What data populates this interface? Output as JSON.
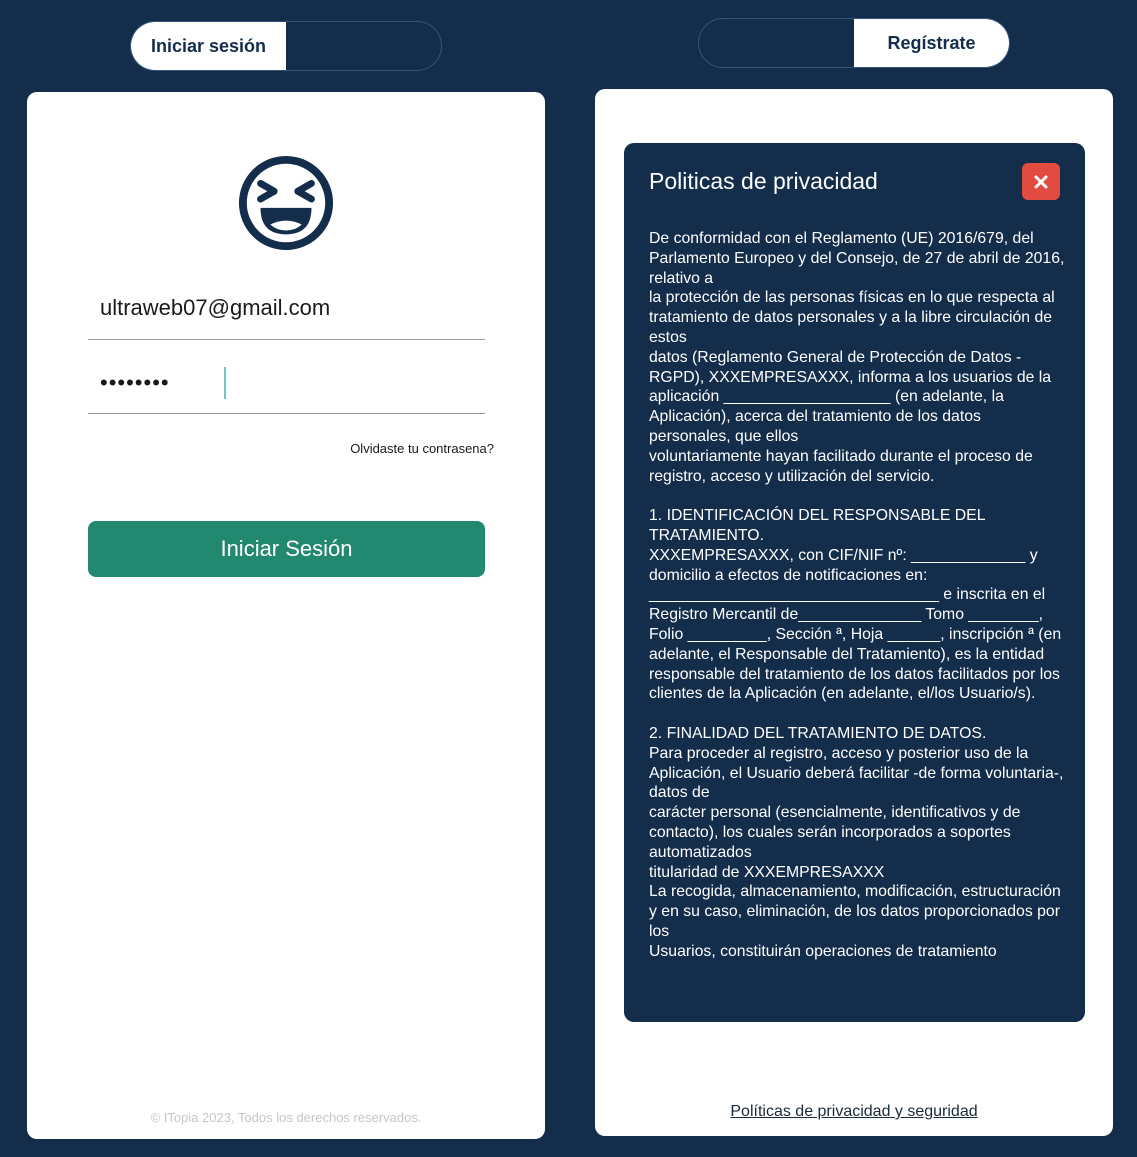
{
  "tabs": {
    "login_label": "Iniciar sesión",
    "register_label": "Regístrate"
  },
  "login": {
    "email_value": "ultraweb07@gmail.com",
    "password_masked": "••••••••",
    "forgot_label": "Olvidaste tu contrasena?",
    "submit_label": "Iniciar Sesión",
    "footer": "© ITopia 2023, Todos los derechos reservados."
  },
  "icons": {
    "avatar": "laughing-face-icon",
    "close": "close-x-icon"
  },
  "colors": {
    "background": "#142d4b",
    "primary_button": "#228870",
    "close_button": "#e24b3f"
  },
  "privacy": {
    "title": "Politicas de privacidad",
    "paragraphs": [
      "De conformidad con el Reglamento (UE) 2016/679, del Parlamento Europeo y del Consejo, de 27 de abril de 2016, relativo a\nla protección de las personas físicas en lo que respecta al tratamiento de datos personales y a la libre circulación de estos\ndatos (Reglamento General de Protección de Datos - RGPD), XXXEMPRESAXXX, informa a los usuarios de la aplicación ___________________ (en adelante, la Aplicación), acerca del tratamiento de los datos personales, que ellos\nvoluntariamente hayan facilitado durante el proceso de registro, acceso y utilización del servicio.",
      "1. IDENTIFICACIÓN DEL RESPONSABLE DEL TRATAMIENTO.\nXXXEMPRESAXXX, con CIF/NIF nº: _____________ y domicilio a efectos de notificaciones en:\n_________________________________ e inscrita en el Registro Mercantil de______________ Tomo ________, Folio _________, Sección ª, Hoja ______, inscripción ª (en adelante, el Responsable del Tratamiento), es la entidad\nresponsable del tratamiento de los datos facilitados por los clientes de la Aplicación (en adelante, el/los Usuario/s).",
      "2. FINALIDAD DEL TRATAMIENTO DE DATOS.\nPara proceder al registro, acceso y posterior uso de la Aplicación, el Usuario deberá facilitar -de forma voluntaria-, datos de\ncarácter personal (esencialmente, identificativos y de contacto), los cuales serán incorporados a soportes automatizados\ntitularidad de XXXEMPRESAXXX\nLa recogida, almacenamiento, modificación, estructuración y en su caso, eliminación, de los datos proporcionados por los\nUsuarios, constituirán operaciones de tratamiento"
    ],
    "footer_link": "Políticas de privacidad y seguridad"
  }
}
